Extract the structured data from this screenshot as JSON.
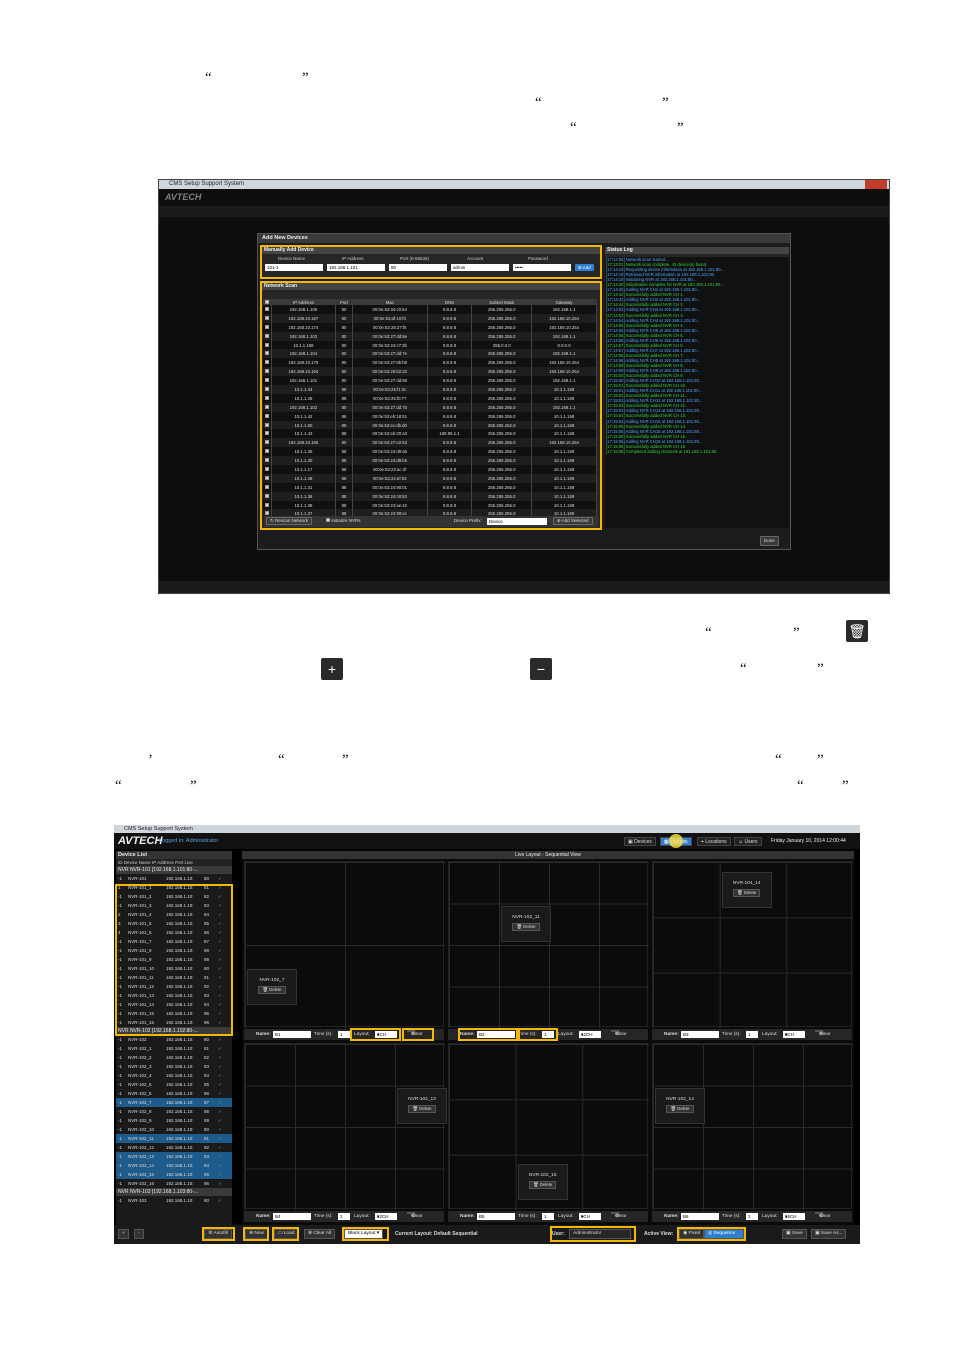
{
  "dialog": {
    "window_title": "CMS Setup Support System",
    "title": "Add New Devices",
    "manual": {
      "header": "Manually Add Device",
      "labels": [
        "Device Name",
        "IP Address",
        "Port (0-65535)",
        "Account",
        "Password"
      ],
      "device_name": "101-1",
      "ip": "192.168.1.101",
      "port": "80",
      "account": "admin",
      "password": "•••••",
      "add_label": "Add"
    },
    "scan": {
      "header": "Network Scan",
      "columns": [
        "IP Address",
        "Port",
        "Mac",
        "DNS",
        "Subnet Mask",
        "Gateway"
      ],
      "rows": [
        [
          "192.168.1.105",
          "80",
          "00:0e:53:34:c0:64",
          "8.8.8.8",
          "255.255.255.0",
          "192.168.1.1"
        ],
        [
          "192.168.10.167",
          "80",
          "00:0e:53:af:10:f3",
          "8.8.8.8",
          "255.255.255.0",
          "192.168.10.254"
        ],
        [
          "192.168.10.174",
          "80",
          "00:0e:53:28:37:f5",
          "8.8.8.8",
          "255.255.255.0",
          "192.168.10.254"
        ],
        [
          "192.168.1.103",
          "80",
          "00:0e:53:27:dd:8e",
          "8.8.8.8",
          "255.255.255.0",
          "192.168.1.1"
        ],
        [
          "10.1.1.158",
          "80",
          "00:0e:53:24:c7:3b",
          "8.8.8.8",
          "255.0.0.0",
          "0.0.0.0"
        ],
        [
          "192.168.1.104",
          "80",
          "00:0e:53:27:dd:7e",
          "8.8.8.8",
          "255.255.255.0",
          "192.168.1.1"
        ],
        [
          "192.168.10.175",
          "80",
          "00:0e:53:27:8b:b8",
          "8.8.8.8",
          "255.255.255.0",
          "192.168.10.254"
        ],
        [
          "192.168.10.164",
          "80",
          "00:0e:53:26:b2:32",
          "8.8.8.8",
          "255.255.255.0",
          "192.168.10.254"
        ],
        [
          "192.168.1.101",
          "80",
          "00:0e:53:27:dd:88",
          "8.8.8.8",
          "255.255.255.0",
          "192.168.1.1"
        ],
        [
          "10.1.1.44",
          "88",
          "00:0e:53:25:f1:3c",
          "8.8.8.8",
          "255.255.255.0",
          "10.1.1.158"
        ],
        [
          "10.1.1.45",
          "88",
          "00:0e:53:25:f0:77",
          "8.8.8.8",
          "255.255.255.0",
          "10.1.1.159"
        ],
        [
          "192.168.1.102",
          "80",
          "00:0e:53:27:dd:7b",
          "8.8.8.8",
          "255.255.255.0",
          "192.168.1.1"
        ],
        [
          "10.1.1.42",
          "88",
          "00:0e:53:eb:18:51",
          "8.8.8.8",
          "255.255.255.0",
          "10.1.1.158"
        ],
        [
          "10.1.1.50",
          "88",
          "00:0e:53:ec:db:d0",
          "8.8.8.8",
          "255.255.252.0",
          "10.1.1.158"
        ],
        [
          "10.1.1.43",
          "88",
          "00:0e:53:eb:20:a3",
          "168.95.1.1",
          "255.255.255.0",
          "10.1.1.158"
        ],
        [
          "192.168.10.165",
          "80",
          "00:0e:53:27:e2:63",
          "8.8.8.8",
          "255.255.255.0",
          "192.168.10.254"
        ],
        [
          "10.1.1.35",
          "88",
          "00:0e:53:24:d9:ab",
          "8.8.8.8",
          "255.255.255.0",
          "10.1.1.159"
        ],
        [
          "10.1.1.30",
          "88",
          "00:0e:53:24:d9:b5",
          "8.8.8.8",
          "255.255.255.0",
          "10.1.1.159"
        ],
        [
          "10.1.1.17",
          "88",
          "00:0e:53:22:ac:2f",
          "8.8.8.8",
          "255.255.255.0",
          "10.1.1.158"
        ],
        [
          "10.1.1.48",
          "88",
          "00:0e:53:22:ef:03",
          "8.8.8.8",
          "255.255.255.0",
          "10.1.1.159"
        ],
        [
          "10.1.1.31",
          "88",
          "00:0e:53:24:90:01",
          "8.8.8.8",
          "255.255.255.0",
          "10.1.1.159"
        ],
        [
          "10.1.1.36",
          "88",
          "00:0e:53:24:c8:53",
          "8.8.8.8",
          "255.255.255.0",
          "10.1.1.159"
        ],
        [
          "10.1.1.38",
          "88",
          "00:0e:53:24:ae:42",
          "8.8.8.8",
          "255.255.255.0",
          "10.1.1.159"
        ],
        [
          "10.1.1.37",
          "88",
          "00:0e:53:24:98:ec",
          "8.8.8.8",
          "255.255.255.0",
          "10.1.1.159"
        ]
      ],
      "rescan_label": "Rescan Network",
      "init_label": "Initialize NVRs",
      "prefix_label": "Device Prefix:",
      "prefix_value": "Device",
      "add_selected_label": "Add Selected"
    },
    "status": {
      "header": "Status Log",
      "lines": [
        "[17:12:55] Network scan started...",
        "[17:13:01] Network scan complete, 43 device(s) found.",
        "[17:14:18] Requesting device information at 192.168.1.101:80...",
        "[17:14:19] Retrieved NVR information at 192.168.1.101:80.",
        "[17:14:19] Initializing NVR at 192.168.1.101:80...",
        "[17:14:40] Initialization complete for NVR at 192.168.1.101:80...",
        "[17:14:40] Adding NVR CH1 at 192.168.1.101:80...",
        "[17:14:42] Successfully added NVR CH 1.",
        "[17:14:42] Adding NVR CH2 at 192.168.1.101:80...",
        "[17:14:44] Successfully added NVR CH 2.",
        "[17:14:52] Adding NVR CH3 at 192.168.1.101:80...",
        "[17:14:53] Successfully added NVR CH 3.",
        "[17:14:54] Adding NVR CH4 at 192.168.1.101:80...",
        "[17:14:55] Successfully added NVR CH 4.",
        "[17:14:55] Adding NVR CH5 at 192.168.1.101:80...",
        "[17:14:56] Successfully added NVR CH 5.",
        "[17:14:56] Adding NVR CH6 at 192.168.1.101:80...",
        "[17:14:57] Successfully added NVR CH 6.",
        "[17:14:57] Adding NVR CH7 at 192.168.1.101:80...",
        "[17:14:58] Successfully added NVR CH 7.",
        "[17:14:58] Adding NVR CH8 at 192.168.1.101:80...",
        "[17:14:59] Successfully added NVR CH 8.",
        "[17:14:59] Adding NVR CH9 at 192.168.1.101:80...",
        "[17:15:00] Successfully added NVR CH 9.",
        "[17:15:00] Adding NVR CH10 at 192.168.1.101:80...",
        "[17:15:01] Successfully added NVR CH 10.",
        "[17:15:01] Adding NVR CH11 at 192.168.1.101:80...",
        "[17:15:02] Successfully added NVR CH 11.",
        "[17:15:02] Adding NVR CH12 at 192.168.1.101:80...",
        "[17:15:03] Successfully added NVR CH 12.",
        "[17:15:03] Adding NVR CH13 at 192.168.1.101:80...",
        "[17:15:04] Successfully added NVR CH 13.",
        "[17:15:04] Adding NVR CH14 at 192.168.1.101:80...",
        "[17:15:05] Successfully added NVR CH 14.",
        "[17:15:05] Adding NVR CH15 at 192.168.1.101:80...",
        "[17:15:06] Successfully added NVR CH 15.",
        "[17:15:06] Adding NVR CH16 at 192.168.1.101:80...",
        "[17:15:08] Successfully added NVR CH 16.",
        "[17:15:08] Completed adding channels at 192.168.1.101:80."
      ]
    },
    "done_label": "Done"
  },
  "layouts": {
    "window_title": "CMS Setup Support System",
    "logo": "AVTECH",
    "subtitle": "Logged in: Administrator",
    "nav": [
      "Devices",
      "Layouts",
      "Locations",
      "Users"
    ],
    "datetime": "Friday January 10, 2014   12:00:44",
    "device_list": {
      "header": "Device List",
      "columns": "ID  Device Name    IP Address    Port  Live",
      "group1": "NVR   NVR-101   [192.168.1.101:80-...",
      "group1_rows": [
        [
          "-1",
          "NVR-101",
          "192.168.1.10:",
          "80",
          "✓"
        ],
        [
          "1",
          "NVR-101_1",
          "192.168.1.10:",
          "81",
          "✓"
        ],
        [
          "-1",
          "NVR-101_2",
          "192.168.1.10:",
          "82",
          "✓"
        ],
        [
          "-1",
          "NVR-101_3",
          "192.168.1.10:",
          "83",
          "✓"
        ],
        [
          "2",
          "NVR-101_4",
          "192.168.1.10:",
          "84",
          "✓"
        ],
        [
          "3",
          "NVR-101_5",
          "192.168.1.10:",
          "85",
          "✓"
        ],
        [
          "4",
          "NVR-101_6",
          "192.168.1.10:",
          "86",
          "✓"
        ],
        [
          "-1",
          "NVR-101_7",
          "192.168.1.10:",
          "87",
          "✓"
        ],
        [
          "-1",
          "NVR-101_8",
          "192.168.1.10:",
          "88",
          "✓"
        ],
        [
          "-1",
          "NVR-101_9",
          "192.168.1.10:",
          "89",
          "✓"
        ],
        [
          "-1",
          "NVR-101_10",
          "192.168.1.10:",
          "90",
          "✓"
        ],
        [
          "-1",
          "NVR-101_11",
          "192.168.1.10:",
          "91",
          "✓"
        ],
        [
          "-1",
          "NVR-101_12",
          "192.168.1.10:",
          "92",
          "✓"
        ],
        [
          "-1",
          "NVR-101_13",
          "192.168.1.10:",
          "93",
          "✓"
        ],
        [
          "-1",
          "NVR-101_14",
          "192.168.1.10:",
          "94",
          "✓"
        ],
        [
          "-1",
          "NVR-101_15",
          "192.168.1.10:",
          "95",
          "✓"
        ],
        [
          "-1",
          "NVR-101_16",
          "192.168.1.10:",
          "96",
          "✓"
        ]
      ],
      "group2": "NVR   NVR-102   [192.168.1.102:80-...",
      "group2_rows": [
        [
          "-1",
          "NVR-102",
          "192.168.1.10:",
          "80",
          "✓"
        ],
        [
          "-1",
          "NVR-102_1",
          "192.168.1.10:",
          "81",
          "✓"
        ],
        [
          "-1",
          "NVR-102_2",
          "192.168.1.10:",
          "82",
          "✓"
        ],
        [
          "-1",
          "NVR-102_3",
          "192.168.1.10:",
          "83",
          "✓"
        ],
        [
          "-1",
          "NVR-102_4",
          "192.168.1.10:",
          "84",
          "✓"
        ],
        [
          "-1",
          "NVR-102_5",
          "192.168.1.10:",
          "85",
          "✓"
        ],
        [
          "-1",
          "NVR-102_6",
          "192.168.1.10:",
          "86",
          "✓"
        ],
        [
          "-1",
          "NVR-102_7",
          "192.168.1.10:",
          "87",
          "✓"
        ],
        [
          "-1",
          "NVR-102_8",
          "192.168.1.10:",
          "88",
          "✓"
        ],
        [
          "-1",
          "NVR-102_9",
          "192.168.1.10:",
          "89",
          "✓"
        ],
        [
          "-1",
          "NVR-102_10",
          "192.168.1.10:",
          "90",
          "✓"
        ],
        [
          "-1",
          "NVR-102_11",
          "192.168.1.10:",
          "91",
          "✓"
        ],
        [
          "-1",
          "NVR-102_12",
          "192.168.1.10:",
          "92",
          "✓"
        ],
        [
          "-1",
          "NVR-102_13",
          "192.168.1.10:",
          "93",
          "✓"
        ],
        [
          "-1",
          "NVR-102_14",
          "192.168.1.10:",
          "94",
          "✓"
        ],
        [
          "-1",
          "NVR-102_15",
          "192.168.1.10:",
          "95",
          "✓"
        ],
        [
          "-1",
          "NVR-102_16",
          "192.168.1.10:",
          "96",
          "✓"
        ]
      ],
      "group3": "NVR   NVR-103   [192.168.1.103:80-...",
      "group3_rows": [
        [
          "-1",
          "NVR-103",
          "192.168.1.10:",
          "80",
          "✓"
        ]
      ]
    },
    "main_header": "Live Layout - Sequential View",
    "panels": [
      {
        "tile": "NVR-102_7",
        "name": "B1",
        "time": "1",
        "layout": "4CH"
      },
      {
        "tile": "NVR-102_11",
        "name": "B2",
        "time": "1",
        "layout": "12CH"
      },
      {
        "tile": "NVR-104_14",
        "name": "B3",
        "time": "1",
        "layout": "9CH"
      },
      {
        "tile": "NVR-102_13",
        "name": "B4",
        "time": "1",
        "layout": "12CH"
      },
      {
        "tile": "NVR-102_15",
        "name": "B5",
        "time": "1",
        "layout": "9CH"
      },
      {
        "tile": "NVR-102_14",
        "name": "B6",
        "time": "1",
        "layout": "16CH"
      }
    ],
    "labels": {
      "name": "Name:",
      "time": "Time (s):",
      "layout": "Layout:",
      "clear": "Clear",
      "delete": "Delete"
    },
    "footer": {
      "add": "+",
      "remove": "-",
      "autofill": "Autofill",
      "new": "New",
      "load": "Load",
      "clear_all": "Clear All",
      "black_layout": "Black Layout",
      "current": "Current Layout: Default Sequential",
      "user_label": "User:",
      "user": "Administrator",
      "active_view": "Active View:",
      "fixed": "Fixed",
      "sequence": "Sequence",
      "save": "Save",
      "save_as": "Save As..."
    }
  },
  "colors": {
    "highlight": "#f5b800",
    "accent": "#2d7fd0",
    "log_green": "#34d33a",
    "log_blue": "#4aa6ff"
  }
}
